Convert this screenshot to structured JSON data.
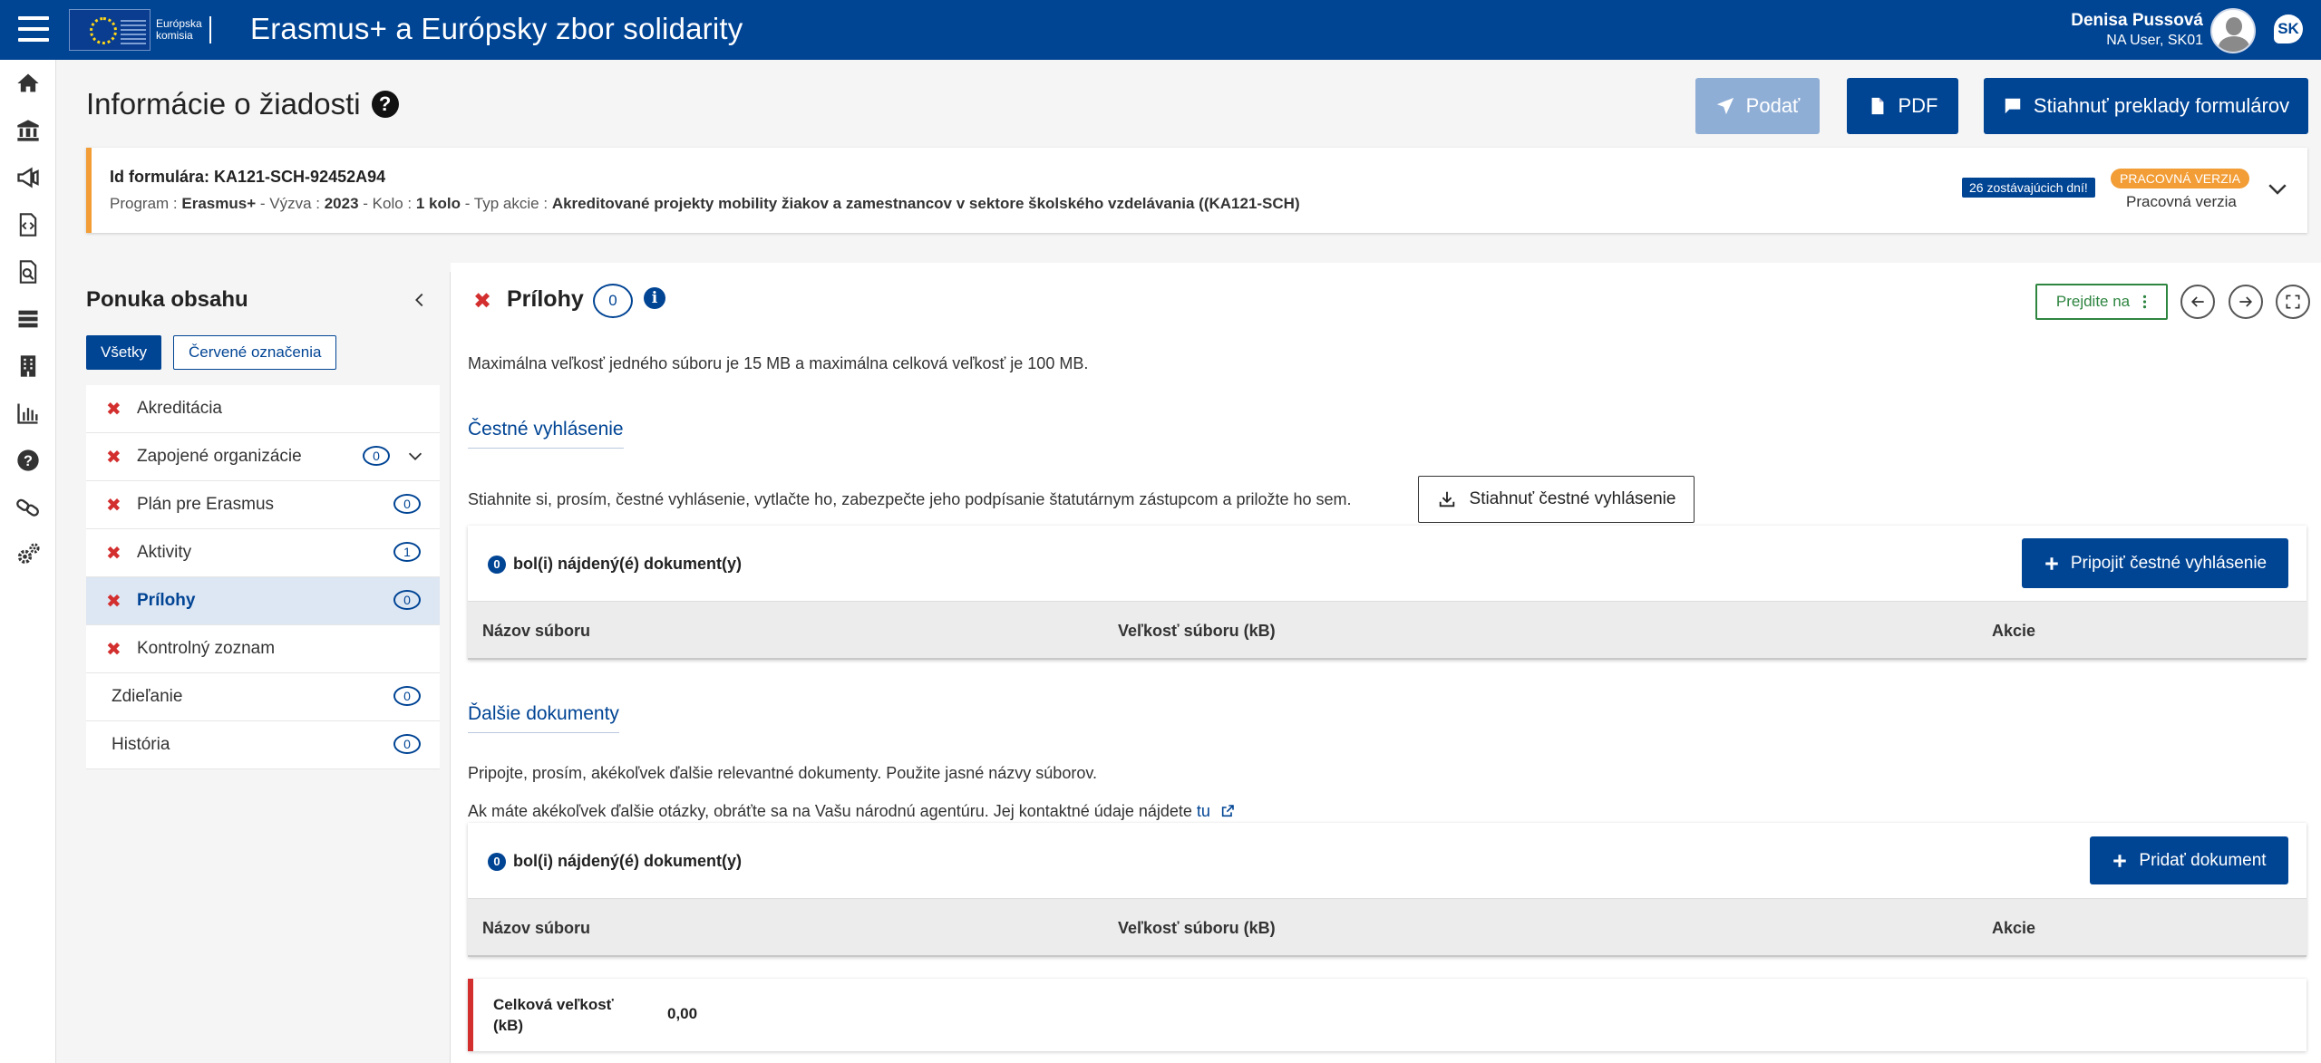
{
  "topbar": {
    "logo_line1": "Európska",
    "logo_line2": "komisia",
    "app_title": "Erasmus+ a Európsky zbor solidarity",
    "user_name": "Denisa Pussová",
    "user_role": "NA User, SK01",
    "lang": "SK"
  },
  "rail": {
    "icons": [
      "home-icon",
      "institution-icon",
      "megaphone-icon",
      "code-document-icon",
      "document-search-icon",
      "list-icon",
      "building-icon",
      "bar-chart-icon",
      "help-icon",
      "link-icon",
      "settings-icon"
    ]
  },
  "page": {
    "title": "Informácie o žiadosti",
    "help_glyph": "?"
  },
  "actions": {
    "submit": "Podať",
    "pdf": "PDF",
    "translations": "Stiahnuť preklady formulárov"
  },
  "banner": {
    "id_label": "Id formulára:",
    "id_value": "KA121-SCH-92452A94",
    "program_label": "Program :",
    "program_value": "Erasmus+",
    "call_label": "- Výzva :",
    "call_value": "2023",
    "round_label": "- Kolo :",
    "round_value": "1 kolo",
    "action_label": "- Typ akcie :",
    "action_value": "Akreditované projekty mobility žiakov a zamestnancov v sektore školského vzdelávania ((KA121-SCH)",
    "days_left": "26 zostávajúcich dní!",
    "version_badge": "PRACOVNÁ VERZIA",
    "version_text": "Pracovná verzia",
    "colors": {
      "accent": "#f29d36",
      "primary": "#004494"
    }
  },
  "menu": {
    "title": "Ponuka obsahu",
    "filter_all": "Všetky",
    "filter_red": "Červené označenia",
    "items": [
      {
        "label": "Akreditácia",
        "error": true,
        "count": null,
        "active": false
      },
      {
        "label": "Zapojené organizácie",
        "error": true,
        "count": "0",
        "active": false,
        "expandable": true
      },
      {
        "label": "Plán pre Erasmus",
        "error": true,
        "count": "0",
        "active": false
      },
      {
        "label": "Aktivity",
        "error": true,
        "count": "1",
        "active": false
      },
      {
        "label": "Prílohy",
        "error": true,
        "count": "0",
        "active": true
      },
      {
        "label": "Kontrolný zoznam",
        "error": true,
        "count": null,
        "active": false
      },
      {
        "label": "Zdieľanie",
        "error": false,
        "count": "0",
        "active": false
      },
      {
        "label": "História",
        "error": false,
        "count": "0",
        "active": false
      }
    ]
  },
  "section": {
    "title": "Prílohy",
    "count": "0",
    "error_glyph": "✖",
    "goto": "Prejdite na",
    "max_size_note": "Maximálna veľkosť jedného súboru je 15 MB a maximálna celková veľkosť je 100 MB.",
    "declaration": {
      "title": "Čestné vyhlásenie",
      "instructions": "Stiahnite si, prosím, čestné vyhlásenie, vytlačte ho, zabezpečte jeho podpísanie štatutárnym zástupcom a priložte ho sem.",
      "download_button": "Stiahnuť čestné vyhlásenie",
      "found_count": "0",
      "found_text": "bol(i) nájdený(é) dokument(y)",
      "attach_button": "Pripojiť čestné vyhlásenie",
      "columns": [
        "Názov súboru",
        "Veľkosť súboru (kB)",
        "Akcie"
      ]
    },
    "other": {
      "title": "Ďalšie dokumenty",
      "instructions": "Pripojte, prosím, akékoľvek ďalšie relevantné dokumenty. Použite jasné názvy súborov.",
      "contact_text": "Ak máte akékoľvek ďalšie otázky, obráťte sa na Vašu národnú agentúru. Jej kontaktné údaje nájdete",
      "contact_link": "tu",
      "found_count": "0",
      "found_text": "bol(i) nájdený(é) dokument(y)",
      "add_button": "Pridať dokument",
      "columns": [
        "Názov súboru",
        "Veľkosť súboru (kB)",
        "Akcie"
      ]
    },
    "total": {
      "label": "Celková veľkosť (kB)",
      "value": "0,00"
    }
  }
}
